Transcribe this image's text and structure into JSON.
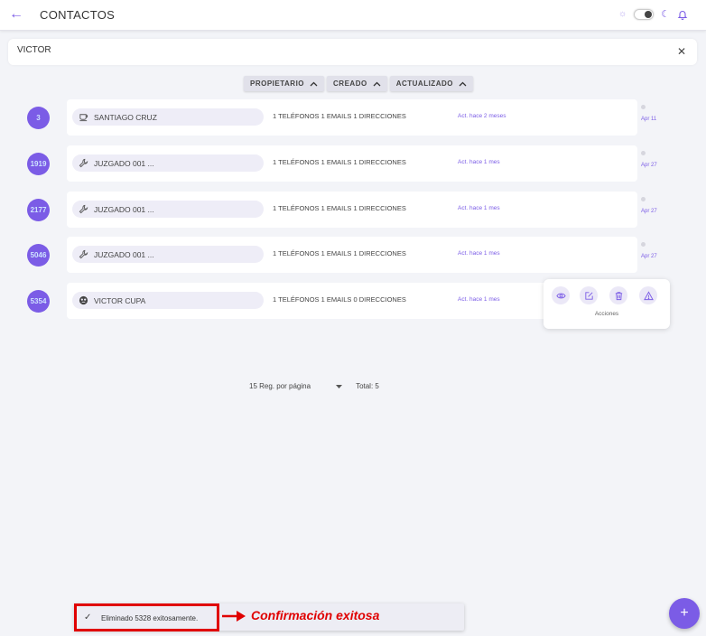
{
  "header": {
    "title": "CONTACTOS"
  },
  "search": {
    "value": "VICTOR"
  },
  "sort": {
    "owner": "PROPIETARIO",
    "created": "CREADO",
    "updated": "ACTUALIZADO"
  },
  "contacts": [
    {
      "id": "3",
      "icon": "coffee-icon",
      "name": "SANTIAGO CRUZ",
      "summary": "1 TELÉFONOS 1 EMAILS 1 DIRECCIONES",
      "updated": "Act. hace 2 meses",
      "date": "Apr 11"
    },
    {
      "id": "1919",
      "icon": "wrench-icon",
      "name": "JUZGADO 001 ...",
      "summary": "1 TELÉFONOS 1 EMAILS 1 DIRECCIONES",
      "updated": "Act. hace 1 mes",
      "date": "Apr 27"
    },
    {
      "id": "2177",
      "icon": "wrench-icon",
      "name": "JUZGADO 001 ...",
      "summary": "1 TELÉFONOS 1 EMAILS 1 DIRECCIONES",
      "updated": "Act. hace 1 mes",
      "date": "Apr 27"
    },
    {
      "id": "5046",
      "icon": "wrench-icon",
      "name": "JUZGADO 001 ...",
      "summary": "1 TELÉFONOS 1 EMAILS 1 DIRECCIONES",
      "updated": "Act. hace 1 mes",
      "date": "Apr 27"
    },
    {
      "id": "5354",
      "icon": "mask-icon",
      "name": "VICTOR CUPA",
      "summary": "1 TELÉFONOS 1 EMAILS 0 DIRECCIONES",
      "updated": "Act. hace 1 mes",
      "date": ""
    }
  ],
  "actions": {
    "label": "Acciones",
    "icons": [
      "eye-icon",
      "edit-icon",
      "trash-icon",
      "warning-icon"
    ]
  },
  "pagination": {
    "per_page": "15 Reg. por página",
    "total": "Total: 5"
  },
  "toast": {
    "message": "Eliminado 5328 exitosamente."
  },
  "annotation": {
    "text": "Confirmación exitosa"
  },
  "colors": {
    "accent": "#7b5ce6",
    "annotation": "#e00000"
  }
}
